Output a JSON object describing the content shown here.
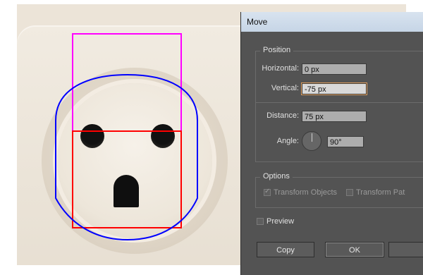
{
  "dialog": {
    "title": "Move",
    "position": {
      "section_label": "Position",
      "horizontal_label": "Horizontal:",
      "horizontal_value": "0 px",
      "vertical_label": "Vertical:",
      "vertical_value": "-75 px",
      "distance_label": "Distance:",
      "distance_value": "75 px",
      "angle_label": "Angle:",
      "angle_value": "90°"
    },
    "options": {
      "section_label": "Options",
      "transform_objects_label": "Transform Objects",
      "transform_objects_checked": true,
      "transform_patterns_label": "Transform Pat"
    },
    "preview_label": "Preview",
    "buttons": {
      "copy": "Copy",
      "ok": "OK"
    }
  },
  "artwork": {
    "guide_colors": {
      "magenta": "#ff00ff",
      "red": "#ff0000",
      "blue": "#0000ff"
    }
  }
}
